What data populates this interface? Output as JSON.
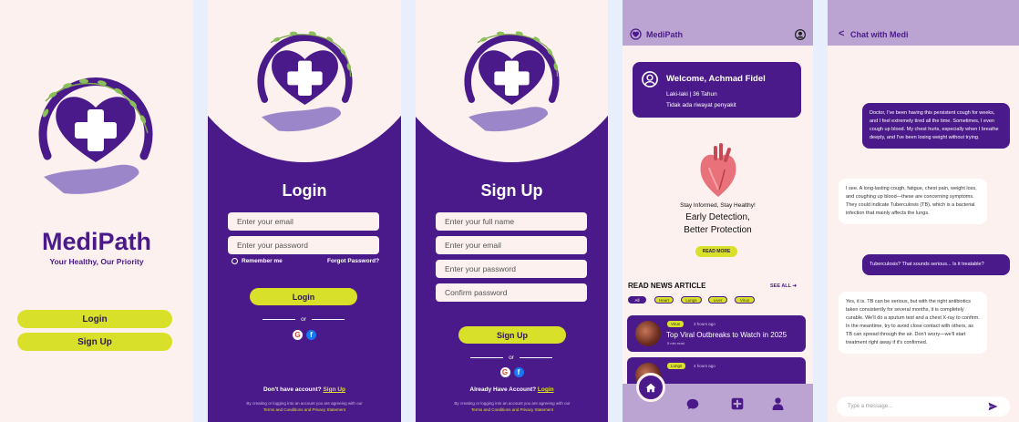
{
  "colors": {
    "primary": "#4b1a8a",
    "accent": "#d9e02a",
    "background": "#fdf1ef",
    "lavender": "#bba3d2"
  },
  "splash": {
    "app_name": "MediPath",
    "tagline": "Your Healthy, Our Priority",
    "login_label": "Login",
    "signup_label": "Sign Up"
  },
  "login": {
    "title": "Login",
    "email_placeholder": "Enter your email",
    "password_placeholder": "Enter your password",
    "remember_label": "Remember me",
    "forgot_label": "Forgot Password?",
    "submit_label": "Login",
    "or_label": "or",
    "no_account_text": "Don't have account?",
    "signup_link": "Sign Up",
    "terms_text": "By creating or logging into an account you are agreeing with our",
    "terms_link": "Terms and Conditions and Privacy Statement"
  },
  "signup": {
    "title": "Sign Up",
    "fullname_placeholder": "Enter your full name",
    "email_placeholder": "Enter your email",
    "password_placeholder": "Enter your password",
    "confirm_placeholder": "Confirm password",
    "submit_label": "Sign Up",
    "or_label": "or",
    "have_account_text": "Already Have Account?",
    "login_link": "Login",
    "terms_text": "By creating or logging into an account you are agreeing with our",
    "terms_link": "Terms and Conditions and Privacy Statement"
  },
  "home": {
    "app_title": "MediPath",
    "welcome_name": "Welcome, Achmad Fidel",
    "profile_line": "Laki-laki | 36 Tahun",
    "history_line": "Tidak ada riwayat penyakit",
    "promo_small": "Stay Informed, Stay Healthy!",
    "promo_line1": "Early Detection,",
    "promo_line2": "Better Protection",
    "read_more": "READ MORE",
    "section_title": "READ NEWS ARTICLE",
    "see_all": "SEE ALL",
    "chips": [
      "All",
      "Heart",
      "Lungs",
      "Liver",
      "Virus"
    ],
    "articles": [
      {
        "tag": "Virus",
        "ago": "3 hours ago",
        "title": "Top Viral Outbreaks to Watch in 2025",
        "read": "5 min read"
      },
      {
        "tag": "Lungs",
        "ago": "4 hours ago"
      }
    ],
    "nav_icons": [
      "home-icon",
      "chat-icon",
      "medical-cross-icon",
      "profile-icon"
    ]
  },
  "chat": {
    "title": "Chat with Medi",
    "messages": [
      {
        "role": "user",
        "text": "Doctor, I've been having this persistent cough for weeks, and I feel extremely tired all the time. Sometimes, I even cough up blood. My chest hurts, especially when I breathe deeply, and I've been losing weight without trying."
      },
      {
        "role": "bot",
        "text": "I see. A long-lasting cough, fatigue, chest pain, weight loss, and coughing up blood—these are concerning symptoms. They could indicate Tuberculosis (TB), which is a bacterial infection that mainly affects the lungs."
      },
      {
        "role": "user",
        "text": "Tuberculosis? That sounds serious... Is it treatable?"
      },
      {
        "role": "bot",
        "text": "Yes, it is. TB can be serious, but with the right antibiotics taken consistently for several months, it is completely curable. We'll do a sputum test and a chest X-ray to confirm. In the meantime, try to avoid close contact with others, as TB can spread through the air. Don't worry—we'll start treatment right away if it's confirmed."
      }
    ],
    "input_placeholder": "Type a message..."
  }
}
